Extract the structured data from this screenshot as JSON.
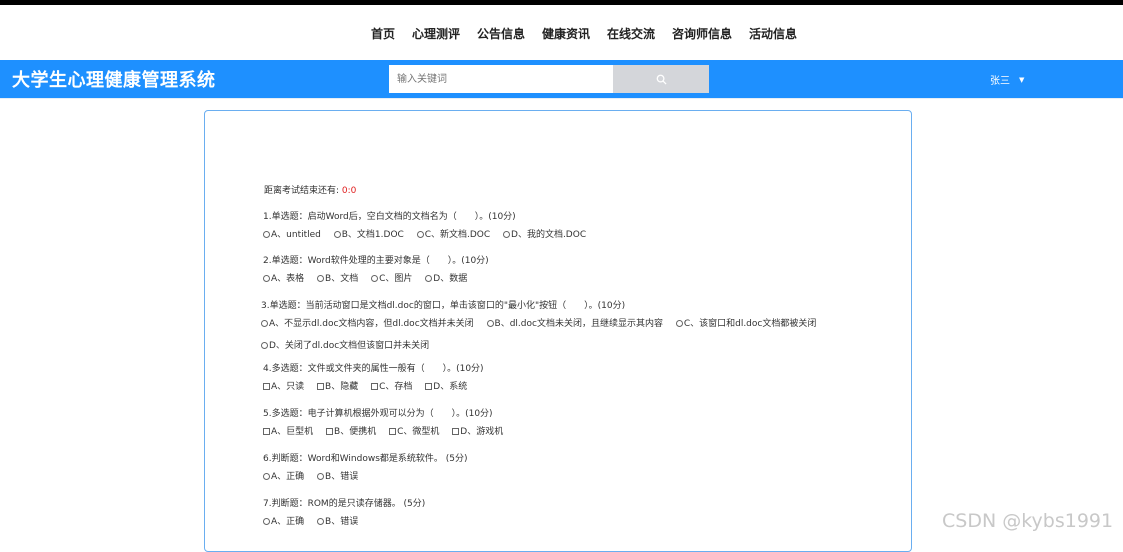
{
  "nav": {
    "items": [
      {
        "label": "首页"
      },
      {
        "label": "心理测评"
      },
      {
        "label": "公告信息"
      },
      {
        "label": "健康资讯"
      },
      {
        "label": "在线交流"
      },
      {
        "label": "咨询师信息"
      },
      {
        "label": "活动信息"
      }
    ]
  },
  "header": {
    "brand": "大学生心理健康管理系统",
    "search_placeholder": "输入关键词",
    "search_icon": "search-icon",
    "user_name": "张三"
  },
  "exam": {
    "timer_label": "距离考试结束还有:",
    "timer_value": "0:0",
    "questions": [
      {
        "title": "1.单选题：启动Word后，空白文档的文档名为（　　）。(10分)",
        "input": "radio",
        "options": [
          "A、untitled",
          "B、文档1.DOC",
          "C、新文档.DOC",
          "D、我的文档.DOC"
        ]
      },
      {
        "title": "2.单选题：Word软件处理的主要对象是（　　）。(10分)",
        "input": "radio",
        "options": [
          "A、表格",
          "B、文档",
          "C、图片",
          "D、数据"
        ]
      },
      {
        "title": "3.单选题：当前活动窗口是文档dl.doc的窗口，单击该窗口的\"最小化\"按钮（　　）。(10分)",
        "input": "radio",
        "options": [
          "A、不显示dl.doc文档内容，但dl.doc文档并未关闭",
          "B、dl.doc文档未关闭，且继续显示其内容",
          "C、该窗口和dl.doc文档都被关闭",
          "D、关闭了dl.doc文档但该窗口并未关闭"
        ]
      },
      {
        "title": "4.多选题：文件或文件夹的属性一般有（　　）。(10分)",
        "input": "checkbox",
        "options": [
          "A、只读",
          "B、隐藏",
          "C、存档",
          "D、系统"
        ]
      },
      {
        "title": "5.多选题：电子计算机根据外观可以分为（　　）。(10分)",
        "input": "checkbox",
        "options": [
          "A、巨型机",
          "B、便携机",
          "C、微型机",
          "D、游戏机"
        ]
      },
      {
        "title": "6.判断题：Word和Windows都是系统软件。 (5分)",
        "input": "radio",
        "options": [
          "A、正确",
          "B、错误"
        ]
      },
      {
        "title": "7.判断题：ROM的是只读存储器。 (5分)",
        "input": "radio",
        "options": [
          "A、正确",
          "B、错误"
        ]
      }
    ]
  },
  "watermark": "CSDN @kybs1991",
  "colors": {
    "header_bg": "#1e90ff",
    "timer_value": "#e02020",
    "panel_border": "#6aaef0"
  }
}
